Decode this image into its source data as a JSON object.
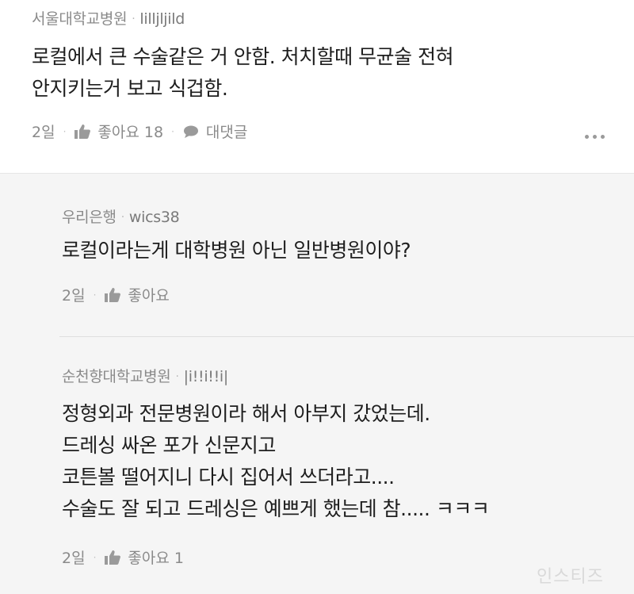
{
  "comments": [
    {
      "author": "서울대학교병원",
      "nickname": "lilljljild",
      "lines": [
        "로컬에서 큰 수술같은 거 안함. 처치할때 무균술 전혀",
        "안지키는거 보고 식겁함."
      ],
      "time": "2일",
      "like_label": "좋아요 18",
      "reply_label": "대댓글"
    },
    {
      "author": "우리은행",
      "nickname": "wics38",
      "lines": [
        "로컬이라는게 대학병원 아닌 일반병원이야?"
      ],
      "time": "2일",
      "like_label": "좋아요"
    },
    {
      "author": "순천향대학교병원",
      "nickname": "|i!!i!!i|",
      "lines": [
        "정형외과 전문병원이라 해서 아부지 갔었는데.",
        "드레싱 싸온 포가 신문지고",
        "코튼볼 떨어지니 다시 집어서 쓰더라고....",
        "수술도 잘 되고 드레싱은 예쁘게 했는데 참..... ㅋㅋㅋ"
      ],
      "time": "2일",
      "like_label": "좋아요 1"
    }
  ],
  "separator": "·",
  "watermark": "인스티즈",
  "icons": {
    "like": "thumbs-up-icon",
    "reply": "speech-bubble-icon",
    "more": "more-dots-icon"
  }
}
